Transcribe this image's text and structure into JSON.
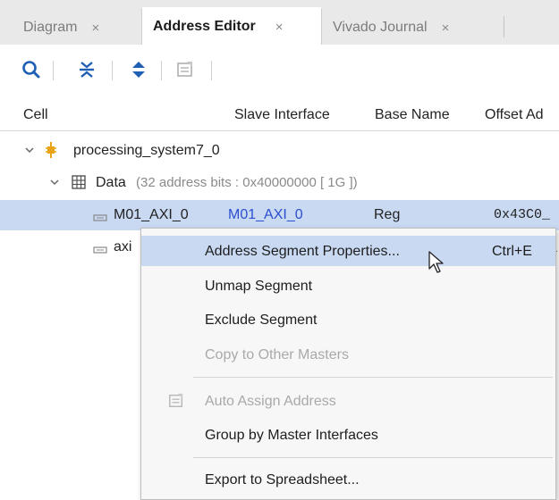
{
  "tabs": [
    {
      "label": "Diagram",
      "close": "×"
    },
    {
      "label": "Address Editor",
      "close": "×",
      "active": true
    },
    {
      "label": "Vivado Journal",
      "close": "×"
    }
  ],
  "toolbar": {
    "icons": [
      "search-icon",
      "collapse-all-icon",
      "expand-all-icon",
      "auto-assign-icon"
    ]
  },
  "columns": [
    "Cell",
    "Slave Interface",
    "Base Name",
    "Offset Ad"
  ],
  "tree": {
    "root": {
      "label": "processing_system7_0",
      "expand_icon": "chevron-down-icon",
      "icon": "processor-icon"
    },
    "data_node": {
      "label": "Data",
      "detail": "(32 address bits : 0x40000000 [ 1G ])",
      "icon": "grid-icon"
    },
    "rows": [
      {
        "cell": "M01_AXI_0",
        "slave_interface": "M01_AXI_0",
        "base_name": "Reg",
        "offset": "0x43C0_",
        "selected": true
      },
      {
        "cell": "axi",
        "slave_interface": "",
        "base_name": "",
        "offset": "_"
      }
    ]
  },
  "context_menu": {
    "items": [
      {
        "label": "Address Segment Properties...",
        "shortcut": "Ctrl+E",
        "highlighted": true,
        "enabled": true
      },
      {
        "label": "Unmap Segment",
        "enabled": true
      },
      {
        "label": "Exclude Segment",
        "enabled": true
      },
      {
        "label": "Copy to Other Masters",
        "enabled": false
      },
      {
        "label": "Auto Assign Address",
        "enabled": false,
        "icon": "auto-assign-icon"
      },
      {
        "label": "Group by Master Interfaces",
        "enabled": true
      },
      {
        "label": "Export to Spreadsheet...",
        "enabled": true
      }
    ]
  },
  "colors": {
    "selection": "#c9d9f2",
    "link_blue": "#2b4fcf",
    "accent_icon_blue": "#1f5fb4",
    "processor_orange": "#e8a317"
  }
}
